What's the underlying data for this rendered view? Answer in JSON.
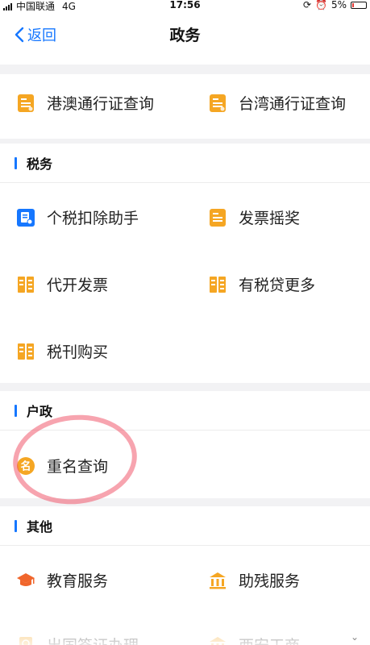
{
  "status_bar": {
    "carrier": "中国联通",
    "network": "4G",
    "time": "17:56",
    "battery": "5%"
  },
  "nav": {
    "back_label": "返回",
    "title": "政务"
  },
  "top_items": [
    {
      "label": "港澳通行证查询",
      "icon": "document-icon"
    },
    {
      "label": "台湾通行证查询",
      "icon": "document-icon"
    }
  ],
  "sections": {
    "tax": {
      "title": "税务",
      "items": [
        {
          "label": "个税扣除助手",
          "icon": "blue-document-icon"
        },
        {
          "label": "发票摇奖",
          "icon": "document-icon"
        },
        {
          "label": "代开发票",
          "icon": "tax-icon"
        },
        {
          "label": "有税贷更多",
          "icon": "tax-icon"
        },
        {
          "label": "税刊购买",
          "icon": "tax-icon"
        }
      ]
    },
    "household": {
      "title": "户政",
      "items": [
        {
          "label": "重名查询",
          "icon": "name-badge-icon",
          "icon_text": "名"
        }
      ]
    },
    "other": {
      "title": "其他",
      "items": [
        {
          "label": "教育服务",
          "icon": "graduation-cap-icon"
        },
        {
          "label": "助残服务",
          "icon": "institution-icon"
        },
        {
          "label": "出国签证办理",
          "icon": "passport-icon"
        },
        {
          "label": "西安工商",
          "icon": "institution-icon"
        }
      ]
    }
  },
  "colors": {
    "accent": "#1677ff",
    "icon_orange": "#f5a623",
    "annotation": "#f05a6e"
  }
}
